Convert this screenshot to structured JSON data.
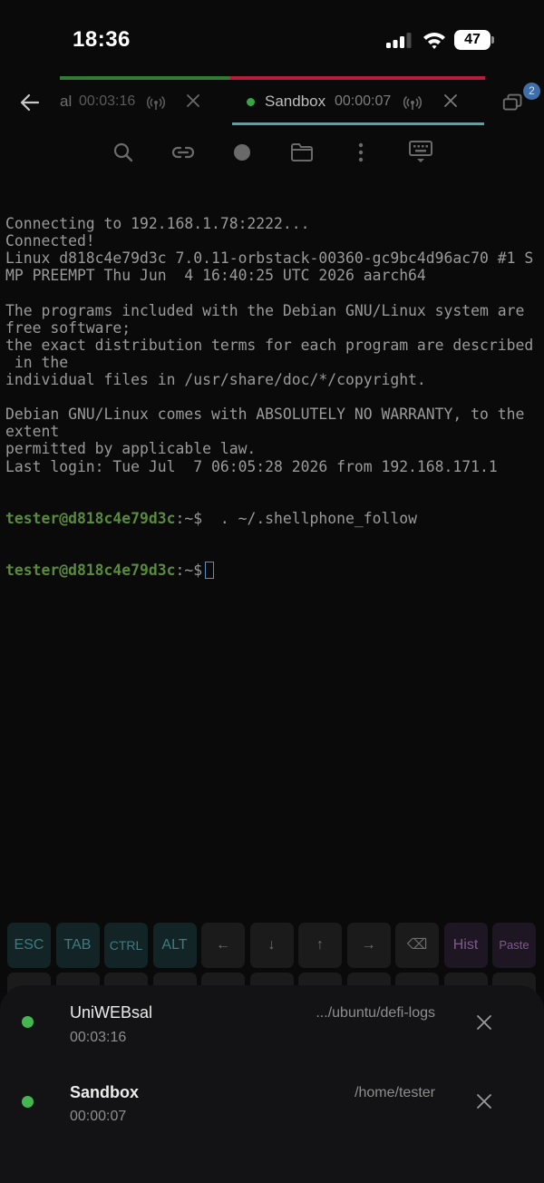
{
  "status_bar": {
    "time": "18:36",
    "battery": "47",
    "icons": [
      "signal-icon",
      "wifi-icon",
      "battery-icon"
    ]
  },
  "session_progress": [
    {
      "color": "#2e7d32",
      "fraction": 0.4
    },
    {
      "color": "#b71c3c",
      "fraction": 0.6
    }
  ],
  "tabs": [
    {
      "label": "al",
      "time": "00:03:16",
      "active": false
    },
    {
      "label": "Sandbox",
      "time": "00:00:07",
      "active": true,
      "status_color": "#3aa346"
    }
  ],
  "sessions_badge": "2",
  "toolbar": {
    "icons": [
      "search-icon",
      "link-icon",
      "record-icon",
      "folder-icon",
      "more-vertical-icon",
      "keyboard-icon"
    ]
  },
  "terminal": {
    "lines": [
      "Connecting to 192.168.1.78:2222...",
      "Connected!",
      "Linux d818c4e79d3c 7.0.11-orbstack-00360-gc9bc4d96ac70 #1 S",
      "MP PREEMPT Thu Jun  4 16:40:25 UTC 2026 aarch64",
      "",
      "The programs included with the Debian GNU/Linux system are",
      "free software;",
      "the exact distribution terms for each program are described",
      " in the",
      "individual files in /usr/share/doc/*/copyright.",
      "",
      "Debian GNU/Linux comes with ABSOLUTELY NO WARRANTY, to the",
      "extent",
      "permitted by applicable law.",
      "Last login: Tue Jul  7 06:05:28 2026 from 192.168.171.1"
    ],
    "prompt_user": "tester@d818c4e79d3c",
    "prompt_suffix": ":~$",
    "command_1": "  . ~/.shellphone_follow",
    "command_2": ""
  },
  "extra_keys": {
    "labels": [
      "ESC",
      "TAB",
      "CTRL",
      "ALT",
      "←",
      "↓",
      "↑",
      "→",
      "⌫",
      "Hist",
      "Paste"
    ]
  },
  "sessions": [
    {
      "name": "UniWEBsal",
      "time": "00:03:16",
      "path": ".../ubuntu/defi-logs",
      "status_color": "#45b652"
    },
    {
      "name": "Sandbox",
      "time": "00:00:07",
      "path": "/home/tester",
      "status_color": "#45b652"
    }
  ]
}
